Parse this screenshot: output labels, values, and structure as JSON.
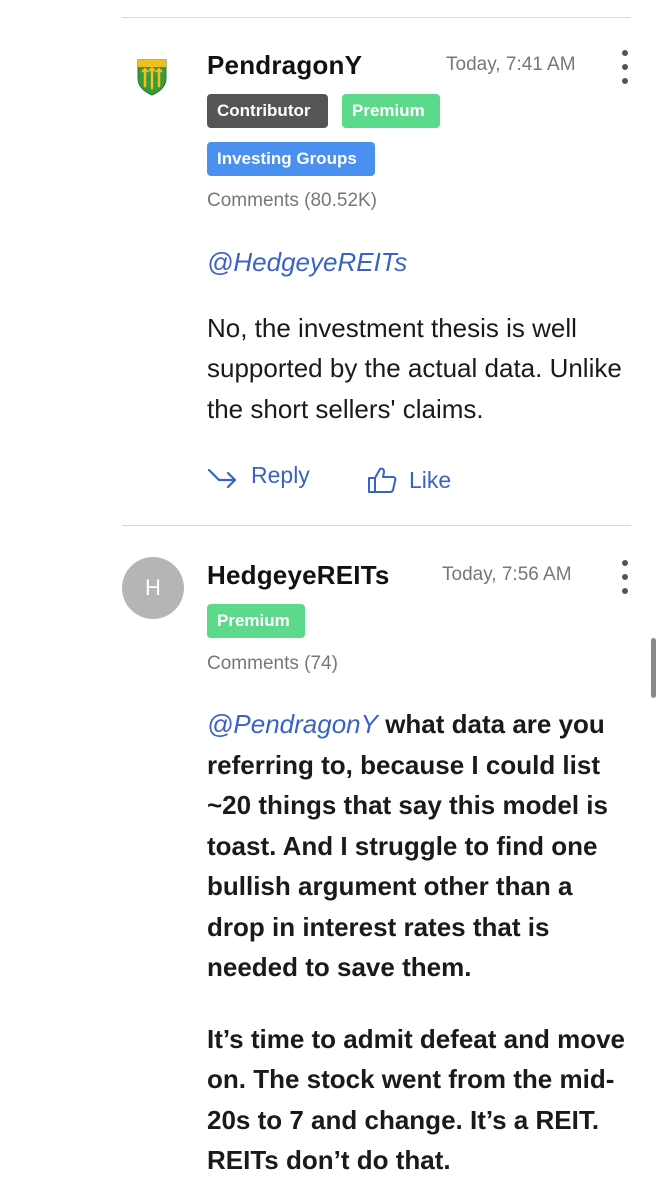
{
  "colors": {
    "link": "#3a63c4",
    "premium_badge": "#5cd98a",
    "contributor_badge": "#555555",
    "investing_badge": "#4a90f0"
  },
  "comments": [
    {
      "username": "PendragonY",
      "avatar": "shield-icon",
      "timestamp": "Today, 7:41 AM",
      "badges": [
        "Contributor",
        "Premium",
        "Investing Groups"
      ],
      "comments_count": "Comments (80.52K)",
      "mention": "@HedgeyeREITs",
      "body": "No, the investment thesis is well supported by the actual data. Unlike the short sellers' claims.",
      "reply_label": "Reply",
      "like_label": "Like"
    },
    {
      "username": "HedgeyeREITs",
      "avatar_letter": "H",
      "timestamp": "Today, 7:56 AM",
      "badges": [
        "Premium"
      ],
      "comments_count": "Comments (74)",
      "mention": "@PendragonY",
      "body_p1": " what data are you referring to, because I could list ~20 things that say this model is toast. And I struggle to find one bullish argument other than a drop in interest rates that is needed to save them.",
      "body_p2": "It’s time to admit defeat and move on. The stock went from the mid-20s to 7 and change. It’s a REIT. REITs don’t do that."
    }
  ]
}
